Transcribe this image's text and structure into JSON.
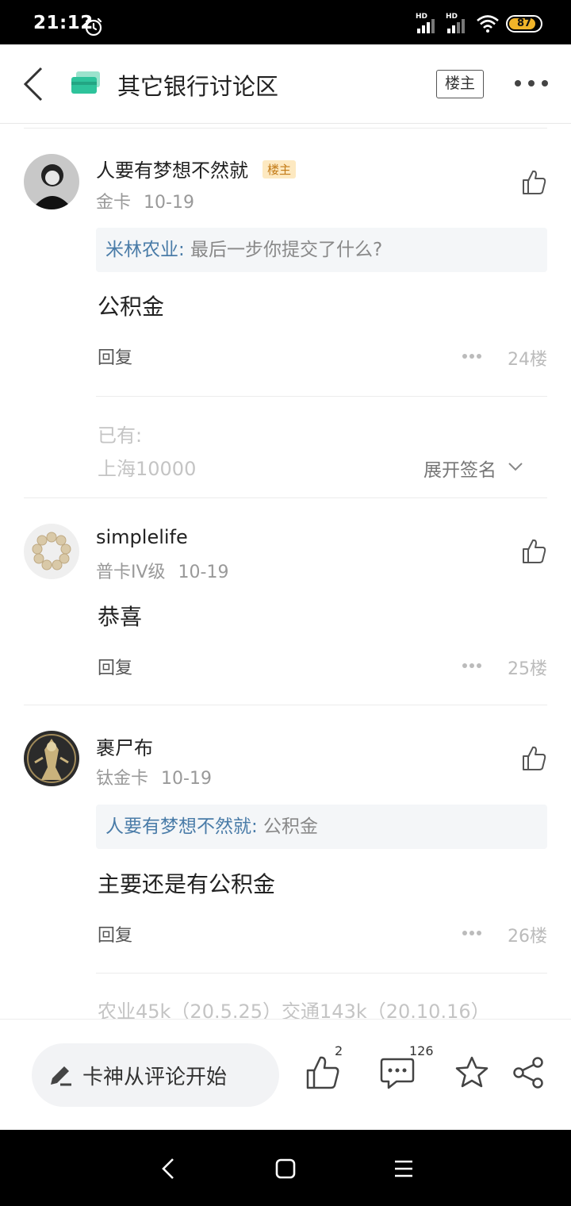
{
  "status_bar": {
    "time": "21:12",
    "signal1_label": "HD",
    "signal2_label": "HD",
    "battery_level": "87",
    "battery_fraction": 0.87,
    "battery_color": "#f0b429"
  },
  "header": {
    "title": "其它银行讨论区",
    "louzhu_button": "楼主",
    "icon_color": "#2ec39b"
  },
  "posts": [
    {
      "user": "人要有梦想不然就",
      "badge": "楼主",
      "level": "金卡",
      "date": "10-19",
      "quote_user": "米林农业:",
      "quote_text": " 最后一步你提交了什么?",
      "text": "公积金",
      "reply": "回复",
      "floor": "24楼",
      "signature": [
        "已有:",
        "上海10000"
      ],
      "expand_label": "展开签名"
    },
    {
      "user": "simplelife",
      "level": "普卡IV级",
      "date": "10-19",
      "text": "恭喜",
      "reply": "回复",
      "floor": "25楼"
    },
    {
      "user": "裹尸布",
      "level": "钛金卡",
      "date": "10-19",
      "quote_user": "人要有梦想不然就:",
      "quote_text": " 公积金",
      "text": "主要还是有公积金",
      "reply": "回复",
      "floor": "26楼",
      "signature": [
        "农业45k（20.5.25）交通143k（20.10.16）"
      ]
    }
  ],
  "action_bar": {
    "comment_placeholder": "卡神从评论开始",
    "like_count": "2",
    "comment_count": "126"
  }
}
